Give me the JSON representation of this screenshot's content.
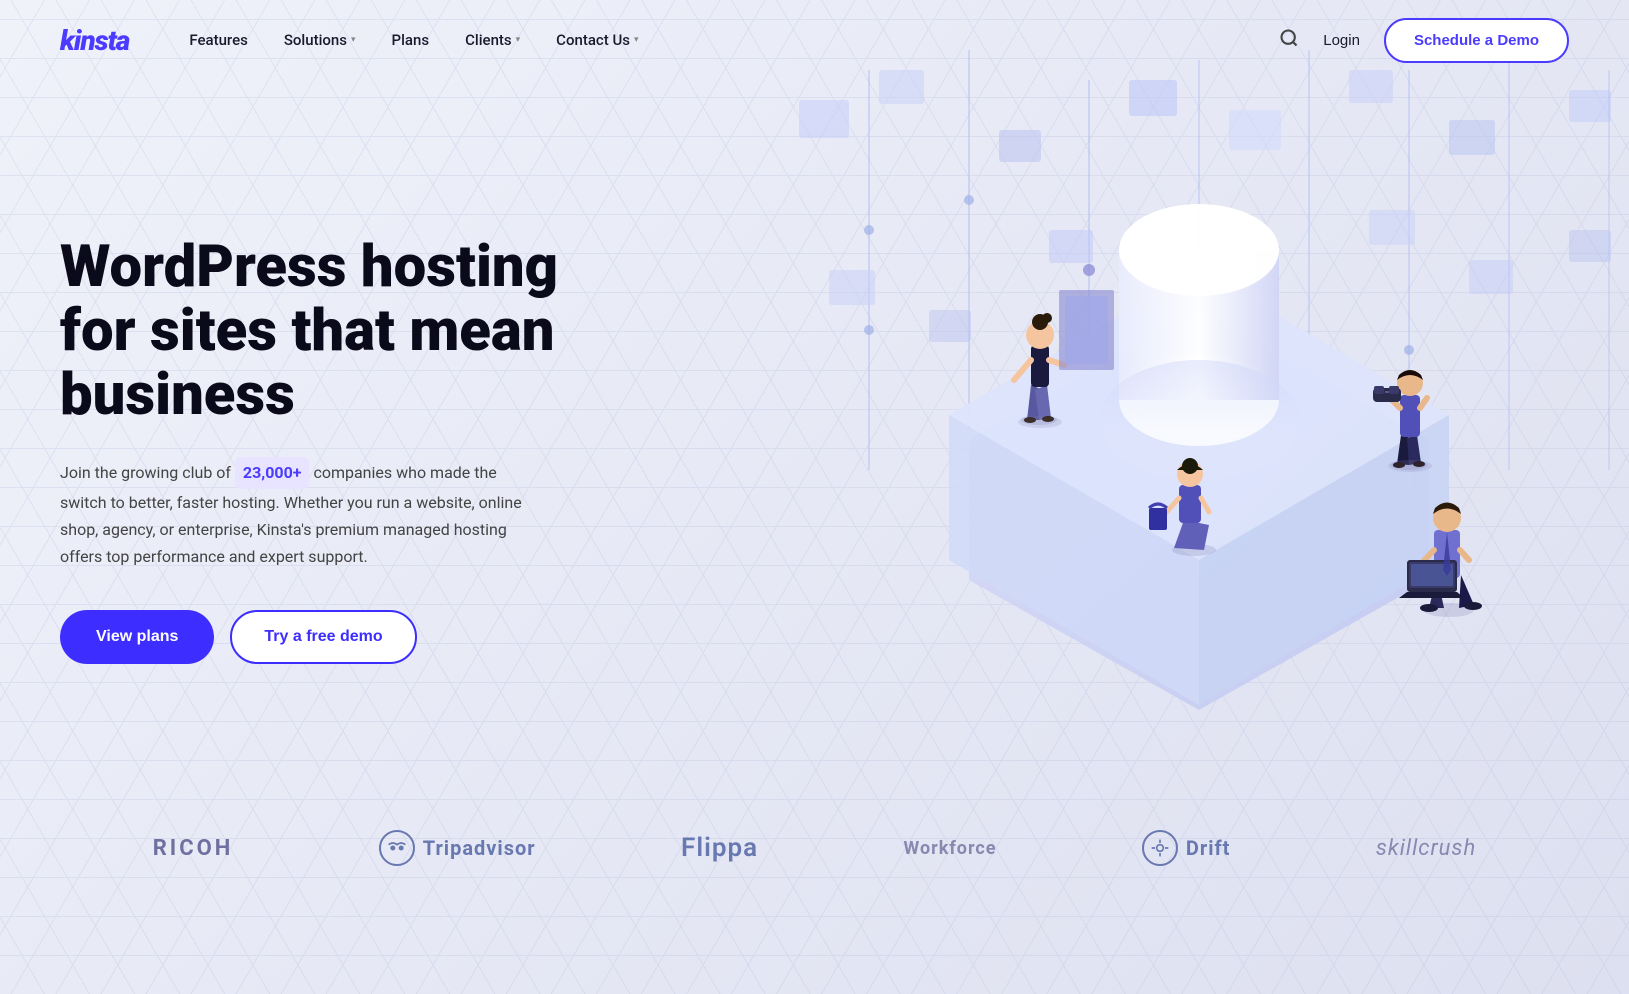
{
  "brand": {
    "name": "kinsta",
    "color": "#4b3bff"
  },
  "nav": {
    "links": [
      {
        "label": "Features",
        "has_dropdown": false
      },
      {
        "label": "Solutions",
        "has_dropdown": true
      },
      {
        "label": "Plans",
        "has_dropdown": false
      },
      {
        "label": "Clients",
        "has_dropdown": true
      },
      {
        "label": "Contact Us",
        "has_dropdown": true
      }
    ],
    "login_label": "Login",
    "schedule_label": "Schedule a Demo"
  },
  "hero": {
    "title": "WordPress hosting for sites that mean business",
    "description_before": "Join the growing club of",
    "highlight": "23,000+",
    "description_after": "companies who made the switch to better, faster hosting. Whether you run a website, online shop, agency, or enterprise, Kinsta's premium managed hosting offers top performance and expert support.",
    "btn_primary": "View plans",
    "btn_secondary": "Try a free demo"
  },
  "logos": [
    {
      "name": "RICOH",
      "type": "text",
      "style": "ricoh"
    },
    {
      "name": "Tripadvisor",
      "type": "icon-text",
      "style": "tripadvisor"
    },
    {
      "name": "Flippa",
      "type": "text",
      "style": "flippa"
    },
    {
      "name": "Workforce",
      "type": "text",
      "style": "workforce"
    },
    {
      "name": "Drift",
      "type": "icon-text",
      "style": "drift"
    },
    {
      "name": "skillcrush",
      "type": "text",
      "style": "skillcrush"
    }
  ],
  "colors": {
    "primary": "#3d2eff",
    "accent": "#4b3bff",
    "background": "#eef0f8",
    "text_dark": "#0a0a1a",
    "text_muted": "#444"
  }
}
